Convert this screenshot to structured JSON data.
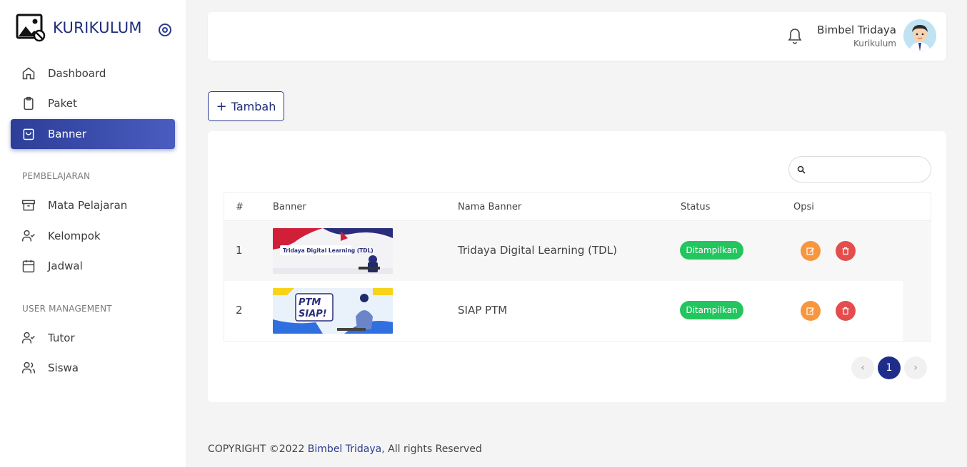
{
  "brand": {
    "title": "KURIKULUM"
  },
  "sidebar": {
    "items": [
      {
        "label": "Dashboard",
        "icon": "home-icon"
      },
      {
        "label": "Paket",
        "icon": "clipboard-icon"
      },
      {
        "label": "Banner",
        "icon": "bag-icon",
        "active": true
      }
    ],
    "section_learning": "PEMBELAJARAN",
    "learning_items": [
      {
        "label": "Mata Pelajaran",
        "icon": "archive-icon"
      },
      {
        "label": "Kelompok",
        "icon": "user-check-icon"
      },
      {
        "label": "Jadwal",
        "icon": "calendar-icon"
      }
    ],
    "section_users": "USER MANAGEMENT",
    "user_items": [
      {
        "label": "Tutor",
        "icon": "user-check-icon"
      },
      {
        "label": "Siswa",
        "icon": "users-icon"
      }
    ]
  },
  "header": {
    "user_name": "Bimbel Tridaya",
    "user_role": "Kurikulum"
  },
  "toolbar": {
    "add_label": "Tambah"
  },
  "search": {
    "placeholder": ""
  },
  "table": {
    "columns": [
      "#",
      "Banner",
      "Nama Banner",
      "Status",
      "Opsi"
    ],
    "rows": [
      {
        "no": "1",
        "name": "Tridaya Digital Learning (TDL)",
        "status": "Ditampilkan",
        "banner_text": "Tridaya Digital Learning (TDL)"
      },
      {
        "no": "2",
        "name": "SIAP PTM",
        "status": "Ditampilkan",
        "banner_text": "PTM SIAP!"
      }
    ]
  },
  "pagination": {
    "prev": "‹",
    "current": "1",
    "next": "›"
  },
  "footer": {
    "copyright": "COPYRIGHT ©2022 ",
    "link": "Bimbel Tridaya",
    "suffix": ", All rights Reserved"
  },
  "colors": {
    "primary": "#1f2d7a",
    "success": "#22c55e",
    "warning": "#f7963d",
    "danger": "#e54d4d"
  }
}
